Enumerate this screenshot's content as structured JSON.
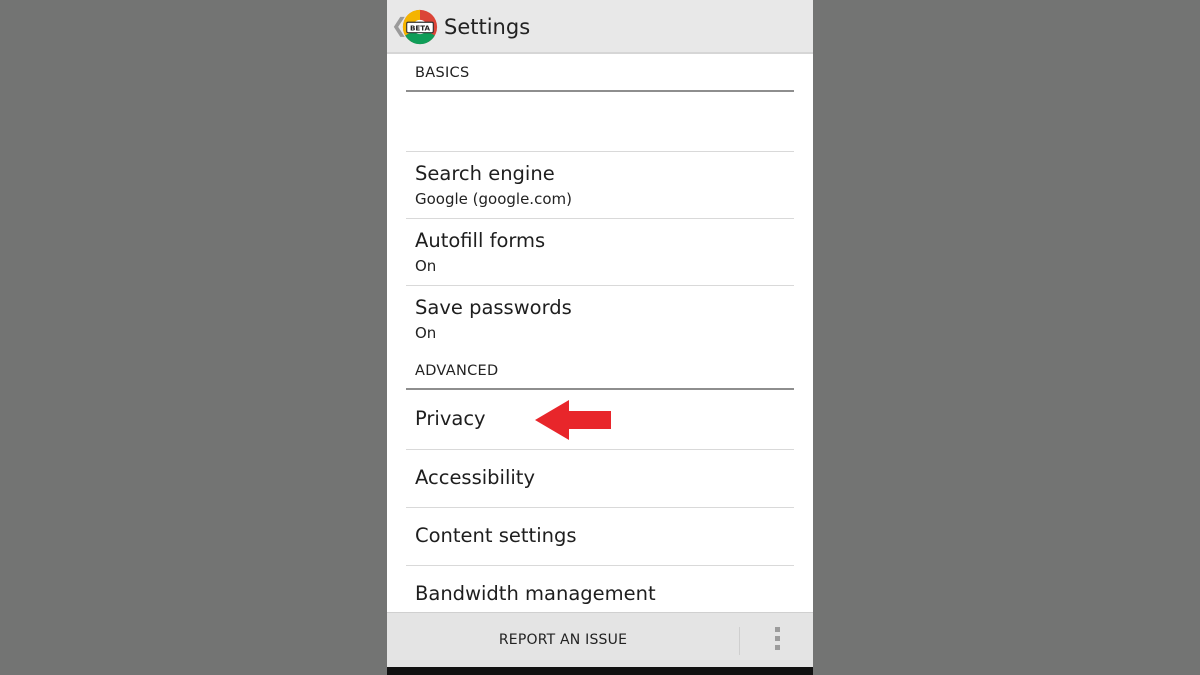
{
  "action_bar": {
    "back_glyph": "❮",
    "app_icon": "chrome-beta-icon",
    "app_icon_label": "BETA",
    "title": "Settings"
  },
  "sections": {
    "basics_label": "BASICS",
    "advanced_label": "ADVANCED"
  },
  "rows": {
    "search_engine": {
      "title": "Search engine",
      "summary": "Google (google.com)"
    },
    "autofill": {
      "title": "Autofill forms",
      "summary": "On"
    },
    "passwords": {
      "title": "Save passwords",
      "summary": "On"
    },
    "privacy": {
      "title": "Privacy"
    },
    "accessibility": {
      "title": "Accessibility"
    },
    "content_settings": {
      "title": "Content settings"
    },
    "bandwidth": {
      "title": "Bandwidth management"
    }
  },
  "annotation": {
    "icon": "red-arrow-left-icon",
    "color": "#e8262b"
  },
  "bottom_bar": {
    "report_label": "REPORT AN ISSUE",
    "menu_icon": "overflow-menu-icon"
  },
  "colors": {
    "background": "#737473",
    "action_bar": "#e8e8e8",
    "divider": "#8e8e8e"
  }
}
